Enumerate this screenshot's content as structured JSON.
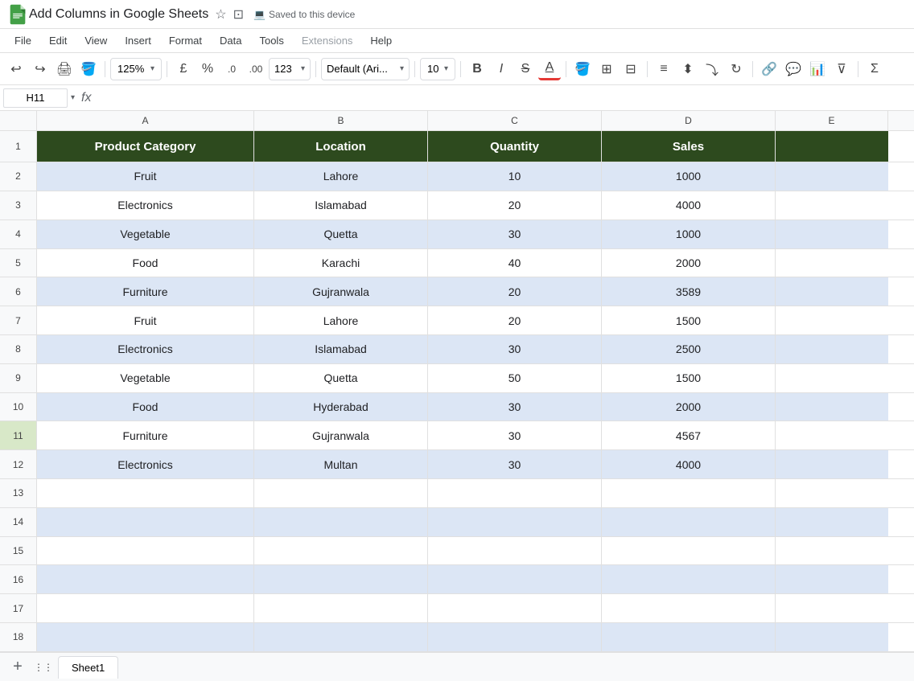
{
  "titlebar": {
    "title": "Add Columns in Google Sheets",
    "saved_text": "Saved to this device"
  },
  "menu": {
    "items": [
      "File",
      "Edit",
      "View",
      "Insert",
      "Format",
      "Data",
      "Tools",
      "Extensions",
      "Help"
    ]
  },
  "toolbar": {
    "zoom": "125%",
    "currency": "£",
    "percent": "%",
    "decimal1": ".0",
    "decimal2": ".00",
    "format123": "123▾",
    "font": "Default (Ari...",
    "font_size": "10"
  },
  "formula_bar": {
    "cell_ref": "H11",
    "formula": ""
  },
  "columns": {
    "headers": [
      "",
      "A",
      "B",
      "C",
      "D",
      "E"
    ],
    "col_labels": [
      "Product Category",
      "Location",
      "Quantity",
      "Sales"
    ]
  },
  "rows": [
    {
      "num": "1",
      "a": "Product Category",
      "b": "Location",
      "c": "Quantity",
      "d": "Sales",
      "is_header": true
    },
    {
      "num": "2",
      "a": "Fruit",
      "b": "Lahore",
      "c": "10",
      "d": "1000",
      "alt": true
    },
    {
      "num": "3",
      "a": "Electronics",
      "b": "Islamabad",
      "c": "20",
      "d": "4000",
      "alt": false
    },
    {
      "num": "4",
      "a": "Vegetable",
      "b": "Quetta",
      "c": "30",
      "d": "1000",
      "alt": true
    },
    {
      "num": "5",
      "a": "Food",
      "b": "Karachi",
      "c": "40",
      "d": "2000",
      "alt": false
    },
    {
      "num": "6",
      "a": "Furniture",
      "b": "Gujranwala",
      "c": "20",
      "d": "3589",
      "alt": true
    },
    {
      "num": "7",
      "a": "Fruit",
      "b": "Lahore",
      "c": "20",
      "d": "1500",
      "alt": false
    },
    {
      "num": "8",
      "a": "Electronics",
      "b": "Islamabad",
      "c": "30",
      "d": "2500",
      "alt": true
    },
    {
      "num": "9",
      "a": "Vegetable",
      "b": "Quetta",
      "c": "50",
      "d": "1500",
      "alt": false
    },
    {
      "num": "10",
      "a": "Food",
      "b": "Hyderabad",
      "c": "30",
      "d": "2000",
      "alt": true
    },
    {
      "num": "11",
      "a": "Furniture",
      "b": "Gujranwala",
      "c": "30",
      "d": "4567",
      "alt": false,
      "selected": true
    },
    {
      "num": "12",
      "a": "Electronics",
      "b": "Multan",
      "c": "30",
      "d": "4000",
      "alt": true
    },
    {
      "num": "13",
      "a": "",
      "b": "",
      "c": "",
      "d": "",
      "alt": false
    },
    {
      "num": "14",
      "a": "",
      "b": "",
      "c": "",
      "d": "",
      "alt": true
    },
    {
      "num": "15",
      "a": "",
      "b": "",
      "c": "",
      "d": "",
      "alt": false
    },
    {
      "num": "16",
      "a": "",
      "b": "",
      "c": "",
      "d": "",
      "alt": true
    },
    {
      "num": "17",
      "a": "",
      "b": "",
      "c": "",
      "d": "",
      "alt": false
    },
    {
      "num": "18",
      "a": "",
      "b": "",
      "c": "",
      "d": "",
      "alt": true
    }
  ],
  "sheets": {
    "tabs": [
      "Sheet1"
    ]
  },
  "colors": {
    "header_bg": "#2d4a1e",
    "header_text": "#ffffff",
    "alt_row": "#e8eef7",
    "selected_row": "#e8eef7",
    "border": "#e0e0e0"
  }
}
